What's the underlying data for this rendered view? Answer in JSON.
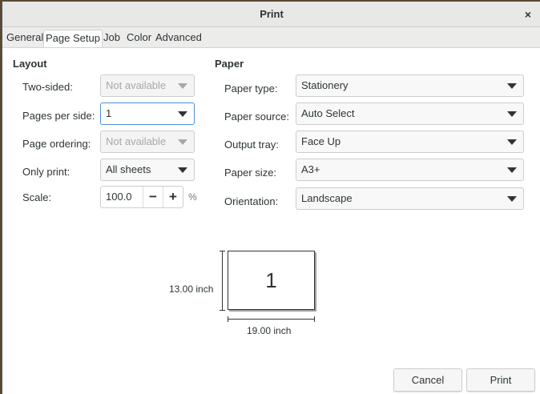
{
  "title": "Print",
  "tabs": [
    "General",
    "Page Setup",
    "Job",
    "Color",
    "Advanced"
  ],
  "layout": {
    "heading": "Layout",
    "two_sided": {
      "label": "Two-sided:",
      "value": "Not available"
    },
    "pages_per_side": {
      "label": "Pages per side:",
      "value": "1"
    },
    "page_ordering": {
      "label": "Page ordering:",
      "value": "Not available"
    },
    "only_print": {
      "label": "Only print:",
      "value": "All sheets"
    },
    "scale": {
      "label": "Scale:",
      "value": "100.0",
      "unit": "%",
      "minus": "−",
      "plus": "+"
    }
  },
  "paper": {
    "heading": "Paper",
    "paper_type": {
      "label": "Paper type:",
      "value": "Stationery"
    },
    "paper_source": {
      "label": "Paper source:",
      "value": "Auto Select"
    },
    "output_tray": {
      "label": "Output tray:",
      "value": "Face Up"
    },
    "paper_size": {
      "label": "Paper size:",
      "value": "A3+"
    },
    "orientation": {
      "label": "Orientation:",
      "value": "Landscape"
    }
  },
  "preview": {
    "page_number": "1",
    "height": "13.00 inch",
    "width": "19.00 inch"
  },
  "buttons": {
    "cancel": "Cancel",
    "print": "Print",
    "close": "×"
  }
}
